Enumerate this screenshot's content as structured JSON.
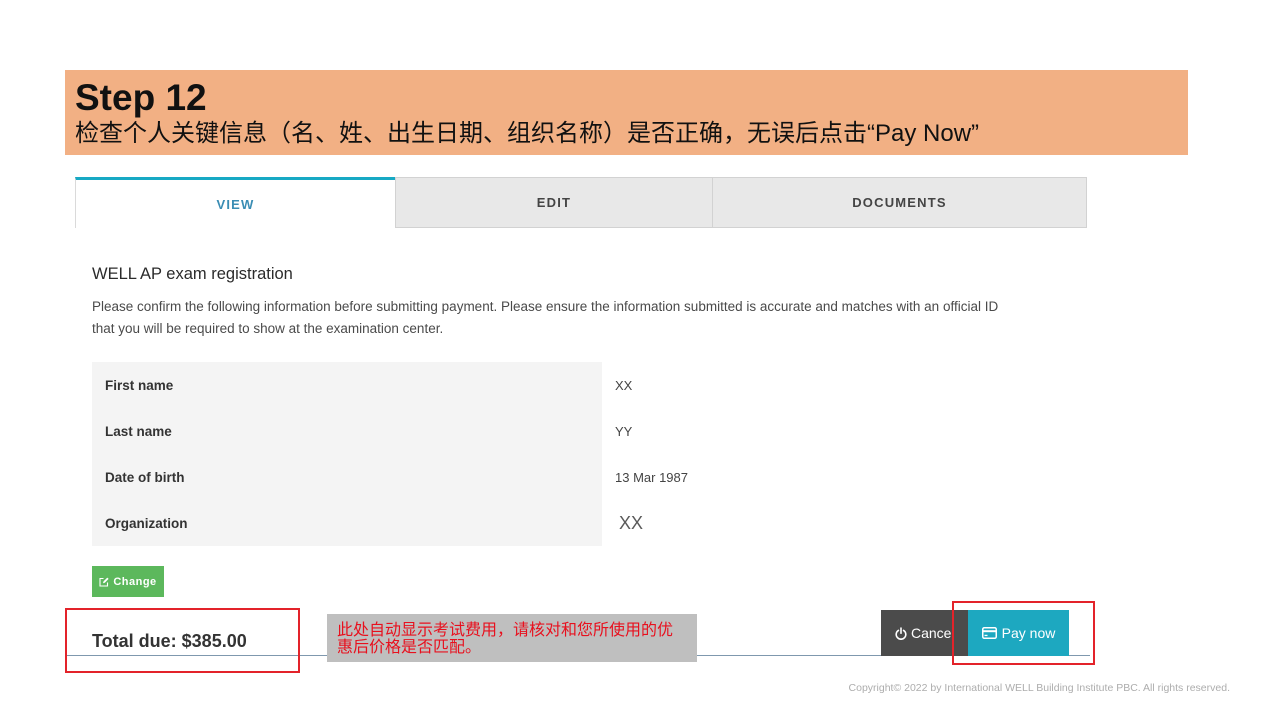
{
  "slide": {
    "step_title": "Step 12",
    "instruction": "检查个人关键信息（名、姓、出生日期、组织名称）是否正确，无误后点击“Pay Now”"
  },
  "tabs": [
    {
      "label": "VIEW",
      "active": true
    },
    {
      "label": "EDIT",
      "active": false
    },
    {
      "label": "DOCUMENTS",
      "active": false
    }
  ],
  "form": {
    "heading": "WELL AP exam registration",
    "description_lines": [
      "Please confirm the following information before submitting payment. Please ensure the information submitted is accurate and matches with an official ID",
      "that you will be required to show at the examination center."
    ],
    "rows": [
      {
        "label": "First name",
        "value": "XX"
      },
      {
        "label": "Last name",
        "value": "YY"
      },
      {
        "label": "Date of birth",
        "value": "13 Mar 1987"
      },
      {
        "label": "Organization",
        "value": "XX"
      }
    ],
    "change_button": {
      "label": "Change",
      "icon": "edit-icon"
    }
  },
  "footer": {
    "total_due": "Total due: $385.00",
    "cancel_button": {
      "label": "Cancel",
      "icon": "power-icon"
    },
    "pay_button": {
      "label": "Pay now",
      "icon": "credit-card-icon"
    }
  },
  "annotation": {
    "note": "此处自动显示考试费用，请核对和您所使用的优惠后价格是否匹配。"
  },
  "copyright": "Copyright© 2022 by International WELL Building Institute PBC. All rights reserved.",
  "colors": {
    "banner": "#F2B084",
    "accent": "#17A9C4",
    "green": "#5CB85C",
    "pay": "#1DA8C0",
    "cancel": "#4B4B4B",
    "red": "#E3232A",
    "note_bg": "#BFBFBF"
  }
}
